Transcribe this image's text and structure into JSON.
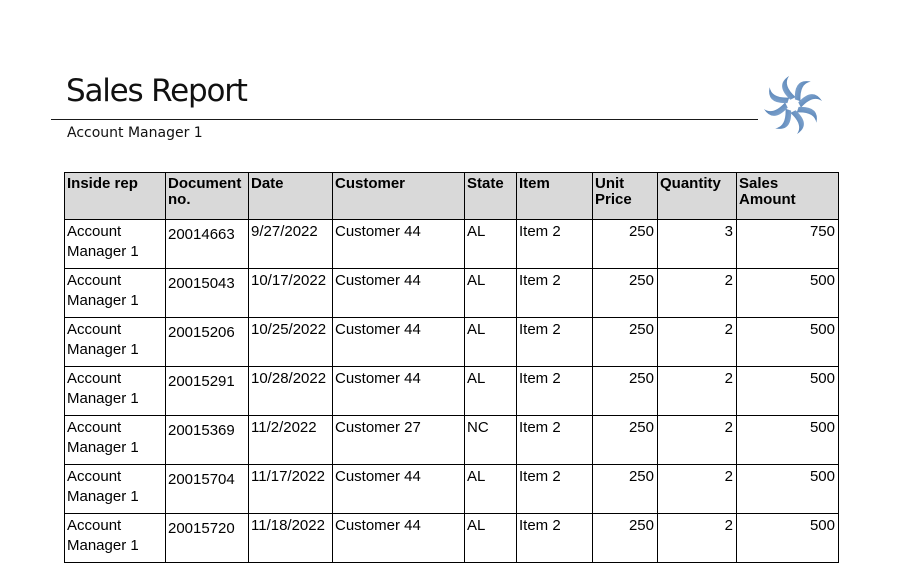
{
  "report": {
    "title": "Sales Report",
    "subtitle": "Account Manager 1"
  },
  "logo": {
    "icon": "swirl-logo-icon",
    "colors": [
      "#3d6ea8",
      "#8fb0d6"
    ]
  },
  "table": {
    "headers": {
      "inside_rep": "Inside rep",
      "document_no": "Document no.",
      "date": "Date",
      "customer": "Customer",
      "state": "State",
      "item": "Item",
      "unit_price": "Unit Price",
      "quantity": "Quantity",
      "sales_amount": "Sales Amount"
    },
    "header_background": "#d9d9d9",
    "rows": [
      {
        "inside_rep": "Account Manager 1",
        "document_no": "20014663",
        "date": "9/27/2022",
        "customer": "Customer 44",
        "state": "AL",
        "item": "Item 2",
        "unit_price": "250",
        "quantity": "3",
        "sales_amount": "750"
      },
      {
        "inside_rep": "Account Manager 1",
        "document_no": "20015043",
        "date": "10/17/2022",
        "customer": "Customer 44",
        "state": "AL",
        "item": "Item 2",
        "unit_price": "250",
        "quantity": "2",
        "sales_amount": "500"
      },
      {
        "inside_rep": "Account Manager 1",
        "document_no": "20015206",
        "date": "10/25/2022",
        "customer": "Customer 44",
        "state": "AL",
        "item": "Item 2",
        "unit_price": "250",
        "quantity": "2",
        "sales_amount": "500"
      },
      {
        "inside_rep": "Account Manager 1",
        "document_no": "20015291",
        "date": "10/28/2022",
        "customer": "Customer 44",
        "state": "AL",
        "item": "Item 2",
        "unit_price": "250",
        "quantity": "2",
        "sales_amount": "500"
      },
      {
        "inside_rep": "Account Manager 1",
        "document_no": "20015369",
        "date": "11/2/2022",
        "customer": "Customer 27",
        "state": "NC",
        "item": "Item 2",
        "unit_price": "250",
        "quantity": "2",
        "sales_amount": "500"
      },
      {
        "inside_rep": "Account Manager 1",
        "document_no": "20015704",
        "date": "11/17/2022",
        "customer": "Customer 44",
        "state": "AL",
        "item": "Item 2",
        "unit_price": "250",
        "quantity": "2",
        "sales_amount": "500"
      },
      {
        "inside_rep": "Account Manager 1",
        "document_no": "20015720",
        "date": "11/18/2022",
        "customer": "Customer 44",
        "state": "AL",
        "item": "Item 2",
        "unit_price": "250",
        "quantity": "2",
        "sales_amount": "500"
      }
    ]
  }
}
